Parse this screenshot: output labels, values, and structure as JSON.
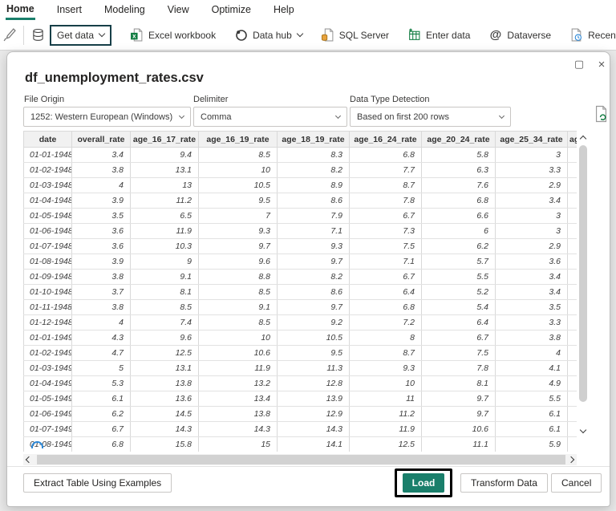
{
  "menu": {
    "items": [
      {
        "label": "Home",
        "active": true
      },
      {
        "label": "Insert",
        "active": false
      },
      {
        "label": "Modeling",
        "active": false
      },
      {
        "label": "View",
        "active": false
      },
      {
        "label": "Optimize",
        "active": false
      },
      {
        "label": "Help",
        "active": false
      }
    ]
  },
  "toolbar": {
    "items": [
      {
        "label": "Get data",
        "icon": "database-icon",
        "chevron": true,
        "highlighted": true
      },
      {
        "label": "Excel workbook",
        "icon": "excel-icon",
        "chevron": false,
        "highlighted": false
      },
      {
        "label": "Data hub",
        "icon": "data-hub-icon",
        "chevron": true,
        "highlighted": false
      },
      {
        "label": "SQL Server",
        "icon": "sql-server-icon",
        "chevron": false,
        "highlighted": false
      },
      {
        "label": "Enter data",
        "icon": "enter-data-icon",
        "chevron": false,
        "highlighted": false
      },
      {
        "label": "Dataverse",
        "icon": "dataverse-icon",
        "chevron": false,
        "highlighted": false
      },
      {
        "label": "Recent sources",
        "icon": "recent-sources-icon",
        "chevron": false,
        "highlighted": false
      }
    ]
  },
  "dialog": {
    "title": "df_unemployment_rates.csv",
    "file_origin": {
      "label": "File Origin",
      "value": "1252: Western European (Windows)"
    },
    "delimiter": {
      "label": "Delimiter",
      "value": "Comma"
    },
    "data_type_detection": {
      "label": "Data Type Detection",
      "value": "Based on first 200 rows"
    },
    "table": {
      "columns": [
        "date",
        "overall_rate",
        "age_16_17_rate",
        "age_16_19_rate",
        "age_18_19_rate",
        "age_16_24_rate",
        "age_20_24_rate",
        "age_25_34_rate",
        "ag"
      ],
      "rows": [
        [
          "01-01-1948",
          "3.4",
          "9.4",
          "8.5",
          "8.3",
          "6.8",
          "5.8",
          "3",
          ""
        ],
        [
          "01-02-1948",
          "3.8",
          "13.1",
          "10",
          "8.2",
          "7.7",
          "6.3",
          "3.3",
          ""
        ],
        [
          "01-03-1948",
          "4",
          "13",
          "10.5",
          "8.9",
          "8.7",
          "7.6",
          "2.9",
          ""
        ],
        [
          "01-04-1948",
          "3.9",
          "11.2",
          "9.5",
          "8.6",
          "7.8",
          "6.8",
          "3.4",
          ""
        ],
        [
          "01-05-1948",
          "3.5",
          "6.5",
          "7",
          "7.9",
          "6.7",
          "6.6",
          "3",
          ""
        ],
        [
          "01-06-1948",
          "3.6",
          "11.9",
          "9.3",
          "7.1",
          "7.3",
          "6",
          "3",
          ""
        ],
        [
          "01-07-1948",
          "3.6",
          "10.3",
          "9.7",
          "9.3",
          "7.5",
          "6.2",
          "2.9",
          ""
        ],
        [
          "01-08-1948",
          "3.9",
          "9",
          "9.6",
          "9.7",
          "7.1",
          "5.7",
          "3.6",
          ""
        ],
        [
          "01-09-1948",
          "3.8",
          "9.1",
          "8.8",
          "8.2",
          "6.7",
          "5.5",
          "3.4",
          ""
        ],
        [
          "01-10-1948",
          "3.7",
          "8.1",
          "8.5",
          "8.6",
          "6.4",
          "5.2",
          "3.4",
          ""
        ],
        [
          "01-11-1948",
          "3.8",
          "8.5",
          "9.1",
          "9.7",
          "6.8",
          "5.4",
          "3.5",
          ""
        ],
        [
          "01-12-1948",
          "4",
          "7.4",
          "8.5",
          "9.2",
          "7.2",
          "6.4",
          "3.3",
          ""
        ],
        [
          "01-01-1949",
          "4.3",
          "9.6",
          "10",
          "10.5",
          "8",
          "6.7",
          "3.8",
          ""
        ],
        [
          "01-02-1949",
          "4.7",
          "12.5",
          "10.6",
          "9.5",
          "8.7",
          "7.5",
          "4",
          ""
        ],
        [
          "01-03-1949",
          "5",
          "13.1",
          "11.9",
          "11.3",
          "9.3",
          "7.8",
          "4.1",
          ""
        ],
        [
          "01-04-1949",
          "5.3",
          "13.8",
          "13.2",
          "12.8",
          "10",
          "8.1",
          "4.9",
          ""
        ],
        [
          "01-05-1949",
          "6.1",
          "13.6",
          "13.4",
          "13.9",
          "11",
          "9.7",
          "5.5",
          ""
        ],
        [
          "01-06-1949",
          "6.2",
          "14.5",
          "13.8",
          "12.9",
          "11.2",
          "9.7",
          "6.1",
          ""
        ],
        [
          "01-07-1949",
          "6.7",
          "14.3",
          "14.3",
          "14.3",
          "11.9",
          "10.6",
          "6.1",
          ""
        ],
        [
          "01-08-1949",
          "6.8",
          "15.8",
          "15",
          "14.1",
          "12.5",
          "11.1",
          "5.9",
          ""
        ]
      ]
    },
    "buttons": {
      "extract": "Extract Table Using Examples",
      "load": "Load",
      "transform": "Transform Data",
      "cancel": "Cancel"
    }
  },
  "colors": {
    "accent_teal": "#1A7F6B",
    "annotation_dark_teal": "#173F48",
    "annotation_black": "#000000",
    "excel_green": "#107C41",
    "sql_amber": "#E8A33D",
    "clock_blue": "#2B88D8"
  }
}
